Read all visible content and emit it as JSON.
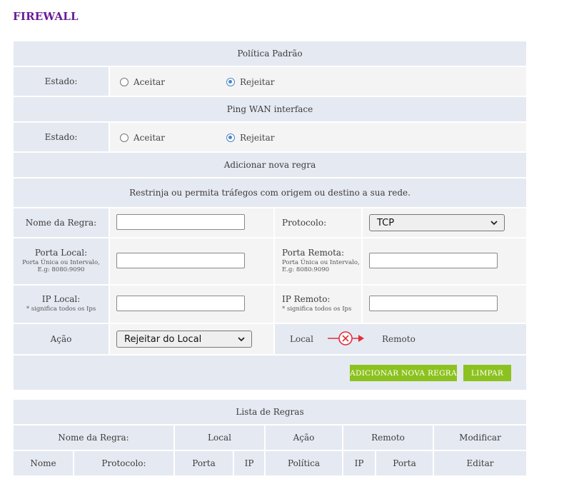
{
  "page": {
    "title": "FIREWALL"
  },
  "default_policy": {
    "header": "Política Padrão",
    "state_label": "Estado:",
    "options": [
      "Aceitar",
      "Rejeitar"
    ],
    "selected": "Rejeitar"
  },
  "ping_wan": {
    "header": "Ping WAN interface",
    "state_label": "Estado:",
    "options": [
      "Aceitar",
      "Rejeitar"
    ],
    "selected": "Rejeitar"
  },
  "add_rule": {
    "header": "Adicionar nova regra",
    "description": "Restrinja ou permita tráfegos com origem ou destino a sua rede.",
    "rule_name_label": "Nome da Regra:",
    "rule_name_value": "",
    "protocol_label": "Protocolo:",
    "protocol_value": "TCP",
    "local_port_label": "Porta Local:",
    "local_port_hint": "Porta Única ou Intervalo,",
    "local_port_hint2": "E.g: 8080:9090",
    "local_port_value": "",
    "remote_port_label": "Porta Remota:",
    "remote_port_hint": "Porta Única ou Intervalo,",
    "remote_port_hint2": "E.g: 8080:9090",
    "remote_port_value": "",
    "local_ip_label": "IP Local:",
    "local_ip_hint": "* significa todos os Ips",
    "local_ip_value": "",
    "remote_ip_label": "IP Remoto:",
    "remote_ip_hint": "* significa todos os Ips",
    "remote_ip_value": "",
    "action_label": "Ação",
    "action_value": "Rejeitar do Local",
    "direction_local": "Local",
    "direction_remote": "Remoto",
    "add_button": "ADICIONAR NOVA REGRA",
    "clear_button": "LIMPAR",
    "accent_color": "#8cc21f",
    "block_color": "#e0303a"
  },
  "rules_list": {
    "header": "Lista de Regras",
    "groups": [
      "Nome da Regra:",
      "Local",
      "Ação",
      "Remoto",
      "Modificar"
    ],
    "columns": [
      "Nome",
      "Protocolo:",
      "Porta",
      "IP",
      "Política",
      "IP",
      "Porta",
      "Editar"
    ]
  }
}
